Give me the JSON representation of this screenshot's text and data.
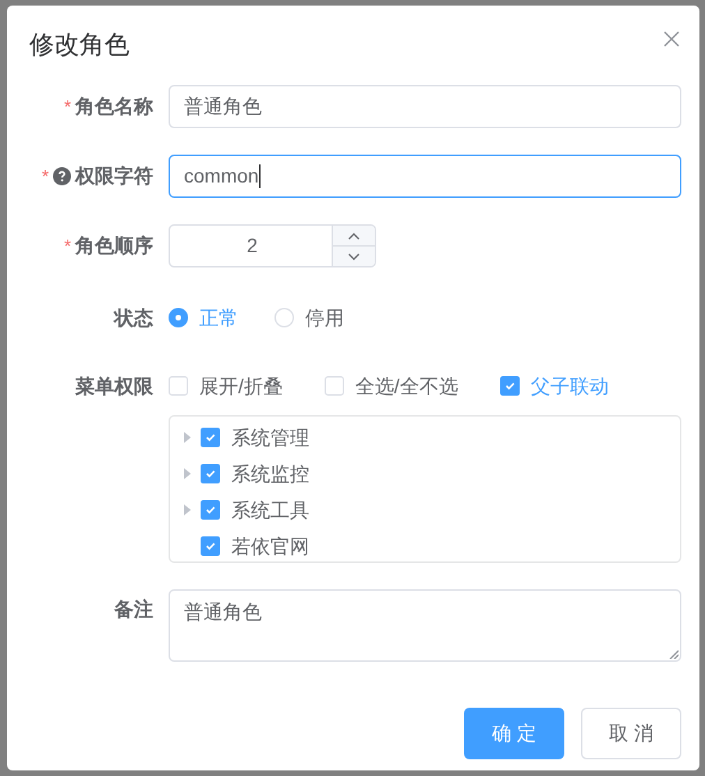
{
  "dialog": {
    "title": "修改角色"
  },
  "fields": [
    {
      "kind": "text",
      "required_mark": "*",
      "label": "角色名称",
      "value": "普通角色",
      "focused": false
    },
    {
      "kind": "text",
      "required_mark": "*",
      "help": true,
      "label": "权限字符",
      "value": "common",
      "focused": true
    },
    {
      "kind": "number",
      "required_mark": "*",
      "label": "角色顺序",
      "value": "2"
    },
    {
      "kind": "radio",
      "label": "状态",
      "options": [
        {
          "label": "正常",
          "selected": true
        },
        {
          "label": "停用",
          "selected": false
        }
      ]
    },
    {
      "kind": "tree",
      "label": "菜单权限",
      "options": [
        {
          "label": "展开/折叠",
          "checked": false
        },
        {
          "label": "全选/全不选",
          "checked": false
        },
        {
          "label": "父子联动",
          "checked": true
        }
      ],
      "nodes": [
        {
          "label": "系统管理",
          "expandable": true,
          "checked": true
        },
        {
          "label": "系统监控",
          "expandable": true,
          "checked": true
        },
        {
          "label": "系统工具",
          "expandable": true,
          "checked": true
        },
        {
          "label": "若依官网",
          "expandable": false,
          "checked": true
        }
      ]
    },
    {
      "kind": "textarea",
      "label": "备注",
      "value": "普通角色"
    }
  ],
  "buttons": [
    {
      "label": "确 定",
      "primary": true
    },
    {
      "label": "取 消",
      "primary": false
    }
  ]
}
